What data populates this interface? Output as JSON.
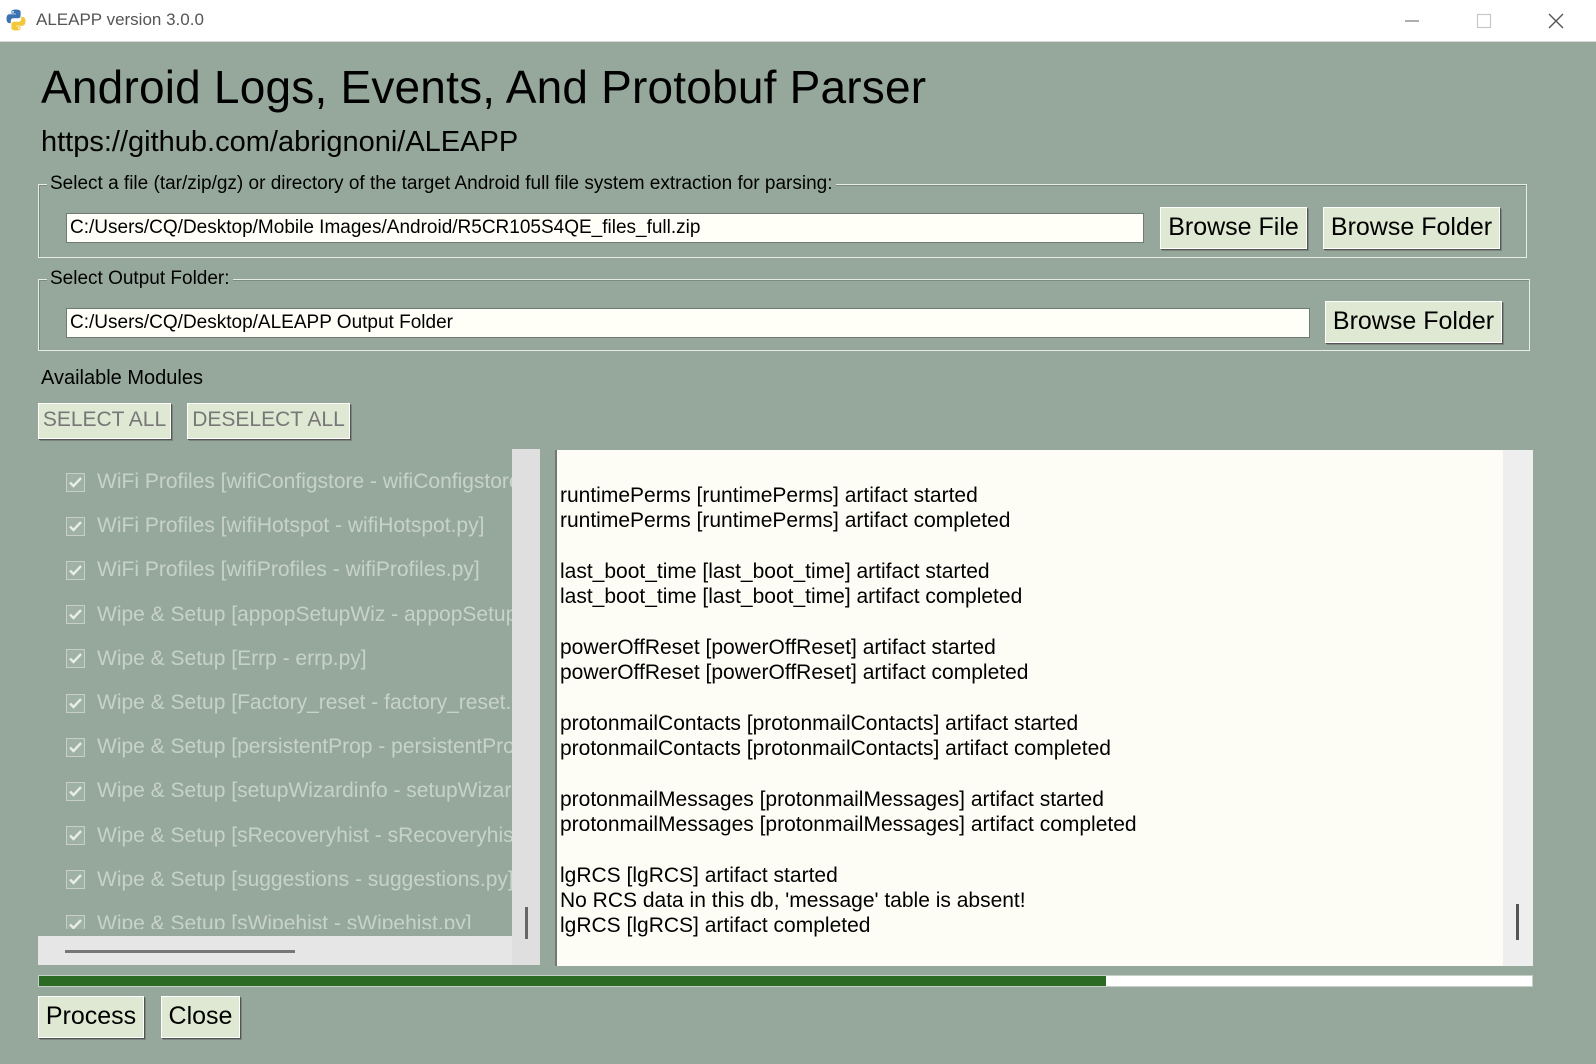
{
  "window": {
    "title": "ALEAPP version 3.0.0",
    "icon": "python-icon",
    "controls": [
      "minimize-icon",
      "maximize-icon",
      "close-icon"
    ]
  },
  "header": {
    "title": "Android Logs, Events, And Protobuf Parser",
    "url": "https://github.com/abrignoni/ALEAPP"
  },
  "input_group": {
    "legend": "Select a file (tar/zip/gz) or directory of the target Android full file system extraction for parsing:",
    "path_value": "C:/Users/CQ/Desktop/Mobile Images/Android/R5CR105S4QE_files_full.zip",
    "browse_file_label": "Browse File",
    "browse_folder_label": "Browse Folder"
  },
  "output_group": {
    "legend": "Select Output Folder:",
    "path_value": "C:/Users/CQ/Desktop/ALEAPP Output Folder",
    "browse_folder_label": "Browse Folder"
  },
  "modules": {
    "label": "Available Modules",
    "select_all_label": "SELECT ALL",
    "deselect_all_label": "DESELECT ALL",
    "items": [
      {
        "label": "WiFi Profiles [wifiConfigstore - wifiConfigstore.",
        "checked": true
      },
      {
        "label": "WiFi Profiles [wifiHotspot - wifiHotspot.py]",
        "checked": true
      },
      {
        "label": "WiFi Profiles [wifiProfiles - wifiProfiles.py]",
        "checked": true
      },
      {
        "label": "Wipe & Setup [appopSetupWiz - appopSetup",
        "checked": true
      },
      {
        "label": "Wipe & Setup [Errp - errp.py]",
        "checked": true
      },
      {
        "label": "Wipe & Setup [Factory_reset - factory_reset.",
        "checked": true
      },
      {
        "label": "Wipe & Setup [persistentProp - persistentPro",
        "checked": true
      },
      {
        "label": "Wipe & Setup [setupWizardinfo - setupWizar",
        "checked": true
      },
      {
        "label": "Wipe & Setup [sRecoveryhist - sRecoveryhist",
        "checked": true
      },
      {
        "label": "Wipe & Setup [suggestions - suggestions.py]",
        "checked": true
      },
      {
        "label": "Wipe & Setup [sWipehist - sWipehist.py]",
        "checked": true
      }
    ]
  },
  "log": {
    "lines": [
      "runtimePerms [runtimePerms] artifact started",
      "runtimePerms [runtimePerms] artifact completed",
      "",
      "last_boot_time [last_boot_time] artifact started",
      "last_boot_time [last_boot_time] artifact completed",
      "",
      "powerOffReset [powerOffReset] artifact started",
      "powerOffReset [powerOffReset] artifact completed",
      "",
      "protonmailContacts [protonmailContacts] artifact started",
      "protonmailContacts [protonmailContacts] artifact completed",
      "",
      "protonmailMessages [protonmailMessages] artifact started",
      "protonmailMessages [protonmailMessages] artifact completed",
      "",
      "lgRCS [lgRCS] artifact started",
      "No RCS data in this db, 'message' table is absent!",
      "lgRCS [lgRCS] artifact completed"
    ]
  },
  "progress": {
    "fraction": 0.715,
    "color": "#2a6a22"
  },
  "actions": {
    "process_label": "Process",
    "close_label": "Close"
  },
  "colors": {
    "window_bg": "#96a89c",
    "button_bg": "#dfe8d2",
    "entry_bg": "#fffff8"
  }
}
